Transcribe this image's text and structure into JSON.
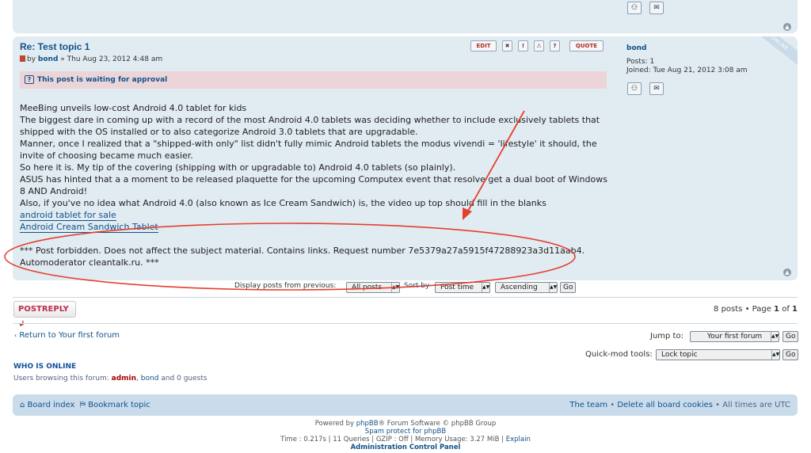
{
  "post": {
    "title": "Re: Test topic 1",
    "meta_by": "by",
    "author": "bond",
    "date": "» Thu Aug 23, 2012 4:48 am",
    "toolbar": {
      "edit": "EDIT",
      "quote": "QUOTE"
    },
    "approval_notice": "This post is waiting for approval",
    "content_lines": [
      "MeeBing unveils low-cost Android 4.0 tablet for kids",
      "The biggest dare in coming up with a record of the most Android 4.0 tablets was deciding whether to include exclusively tablets that shipped with the OS installed or to also categorize Android 3.0 tablets that are upgradable.",
      "Manner, once I realized that a \"shipped-with only\" list didn't fully mimic Android tablets the modus vivendi = 'lifestyle' it should, the invite of choosing became much easier.",
      "So here it is. My tip of the covering (shipping with or upgradable to) Android 4.0 tablets (so plainly).",
      "ASUS has hinted that a a moment to be released plaquette for the upcoming Computex event that resolve get a dual boot of Windows 8 AND Android!",
      "Also, if you've no idea what Android 4.0 (also known as Ice Cream Sandwich) is, the video up top should fill in the blanks"
    ],
    "links": [
      "android tablet for sale",
      "Android Cream Sandwich Tablet"
    ],
    "forbidden_message": "*** Post forbidden. Does not affect the subject material. Contains links. Request number 7e5379a27a5915f47288923a3d11aab4. Automoderator cleantalk.ru. ***"
  },
  "profile": {
    "name": "bond",
    "posts_label": "Posts:",
    "posts_value": "1",
    "joined_label": "Joined:",
    "joined_value": "Tue Aug 21, 2012 3:08 am",
    "online_badge": "ONLINE"
  },
  "display": {
    "label": "Display posts from previous:",
    "days_value": "All posts",
    "sort_label": "Sort by",
    "sort_value": "Post time",
    "order_value": "Ascending",
    "go": "Go"
  },
  "actions": {
    "post_reply": "POSTREPLY",
    "pagination": "8 posts • Page",
    "page_current": "1",
    "page_of": "of",
    "page_total": "1"
  },
  "nav": {
    "return_link": "Return to Your first forum",
    "jump_label": "Jump to:",
    "jump_value": "Your first forum",
    "quickmod_label": "Quick-mod tools:",
    "quickmod_value": "Lock topic",
    "go": "Go"
  },
  "who_online": {
    "title": "WHO IS ONLINE",
    "prefix": "Users browsing this forum:",
    "admin": "admin",
    "sep1": ",",
    "bond": "bond",
    "suffix": "and 0 guests"
  },
  "navbar": {
    "board_index": "Board index",
    "bookmark": "Bookmark topic",
    "team": "The team",
    "delete_cookies": "Delete all board cookies",
    "timezone": "All times are UTC",
    "bullet": "•"
  },
  "footer": {
    "powered_prefix": "Powered by",
    "phpbb_link": "phpBB",
    "powered_suffix": "® Forum Software © phpBB Group",
    "spam_protect": "Spam protect for phpBB",
    "stats": "Time : 0.217s | 11 Queries | GZIP : Off | Memory Usage: 3.27 MiB |",
    "explain": "Explain",
    "acp": "Administration Control Panel"
  },
  "colors": {
    "panel_bg": "#e1ebf2",
    "link": "#105289",
    "approval_bg": "#ecd5d8",
    "annotation_red": "#e53f2f"
  }
}
